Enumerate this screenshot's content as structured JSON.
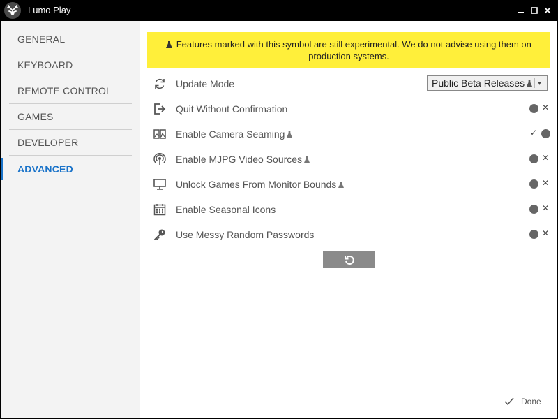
{
  "window": {
    "title": "Lumo Play",
    "logo_icon": "antlers-logo-icon",
    "controls": [
      "minimize-icon",
      "maximize-icon",
      "close-icon"
    ]
  },
  "sidebar": {
    "items": [
      {
        "label": "GENERAL",
        "active": false
      },
      {
        "label": "KEYBOARD",
        "active": false
      },
      {
        "label": "REMOTE CONTROL",
        "active": false
      },
      {
        "label": "GAMES",
        "active": false
      },
      {
        "label": "DEVELOPER",
        "active": false
      },
      {
        "label": "ADVANCED",
        "active": true
      }
    ]
  },
  "banner": {
    "text": "Features marked with this symbol are still experimental. We do not advise using them on production systems.",
    "icon": "flask-icon",
    "background": "#ffef3a"
  },
  "settings": [
    {
      "label": "Update Mode",
      "icon": "refresh-icon",
      "experimental": false,
      "control": "select",
      "value": "Public Beta Releases",
      "value_experimental": true
    },
    {
      "label": "Quit Without Confirmation",
      "icon": "exit-icon",
      "experimental": false,
      "control": "toggle",
      "enabled": false
    },
    {
      "label": "Enable Camera Seaming",
      "icon": "camera-seam-icon",
      "experimental": true,
      "control": "toggle",
      "enabled": true
    },
    {
      "label": "Enable MJPG Video Sources",
      "icon": "broadcast-icon",
      "experimental": true,
      "control": "toggle",
      "enabled": false
    },
    {
      "label": "Unlock Games From Monitor Bounds",
      "icon": "monitor-icon",
      "experimental": true,
      "control": "toggle",
      "enabled": false
    },
    {
      "label": "Enable Seasonal Icons",
      "icon": "calendar-icon",
      "experimental": false,
      "control": "toggle",
      "enabled": false
    },
    {
      "label": "Use Messy Random Passwords",
      "icon": "key-icon",
      "experimental": false,
      "control": "toggle",
      "enabled": false
    }
  ],
  "reset": {
    "icon": "reset-icon"
  },
  "footer": {
    "done_label": "Done",
    "done_icon": "check-icon"
  },
  "colors": {
    "accent": "#1a73c9",
    "toggle_knob": "#666666",
    "button_gray": "#8a8a8a"
  }
}
